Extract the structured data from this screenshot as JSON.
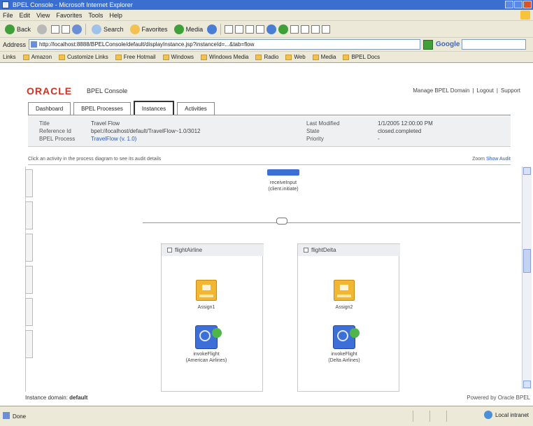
{
  "browser": {
    "title": "BPEL Console - Microsoft Internet Explorer",
    "menu": [
      "File",
      "Edit",
      "View",
      "Favorites",
      "Tools",
      "Help"
    ],
    "toolbar": [
      "Back",
      "Search",
      "Favorites",
      "Media"
    ],
    "address_label": "Address",
    "address_value": "http://localhost:8888/BPELConsole/default/displayInstance.jsp?instanceId=...&tab=flow",
    "go_label": "Go",
    "search_engine": "Google",
    "links": [
      "Links",
      "Amazon",
      "Customize Links",
      "Free Hotmail",
      "Windows",
      "Windows Media",
      "Radio",
      "Web",
      "Media",
      "BPEL Docs"
    ],
    "status_text": "Done",
    "zone_label": "Local intranet"
  },
  "page": {
    "logo": "ORACLE",
    "console_title": "BPEL Console",
    "top_links": [
      "Manage BPEL Domain",
      "Logout",
      "Support"
    ],
    "tabs": [
      {
        "label": "Dashboard",
        "active": false
      },
      {
        "label": "BPEL Processes",
        "active": false
      },
      {
        "label": "Instances",
        "active": true
      },
      {
        "label": "Activities",
        "active": false
      }
    ],
    "info": {
      "title_label": "Title",
      "title_value": "Travel Flow",
      "ref_label": "Reference Id",
      "ref_value": "bpel://localhost/default/TravelFlow~1.0/3012",
      "proc_label": "BPEL Process",
      "proc_value": "TravelFlow (v. 1.0)",
      "modified_label": "Last Modified",
      "modified_value": "1/1/2005 12:00:00 PM",
      "state_label": "State",
      "state_value": "closed.completed",
      "priority_label": "Priority",
      "priority_value": "-"
    },
    "hint": "Click an activity in the process diagram to see its audit details",
    "zoom_label": "Zoom",
    "zoom_link": "Show Audit",
    "start_label": "receiveInput\n(client.initiate)",
    "lanes": [
      {
        "title": "flightAirline",
        "assign": "Assign1",
        "invoke": "invokeFlight\n(American Airlines)"
      },
      {
        "title": "flightDelta",
        "assign": "Assign2",
        "invoke": "invokeFlight\n(Delta Airlines)"
      }
    ],
    "status_left_label": "Instance domain:",
    "status_left_value": "default",
    "status_right": "Powered by Oracle BPEL"
  }
}
